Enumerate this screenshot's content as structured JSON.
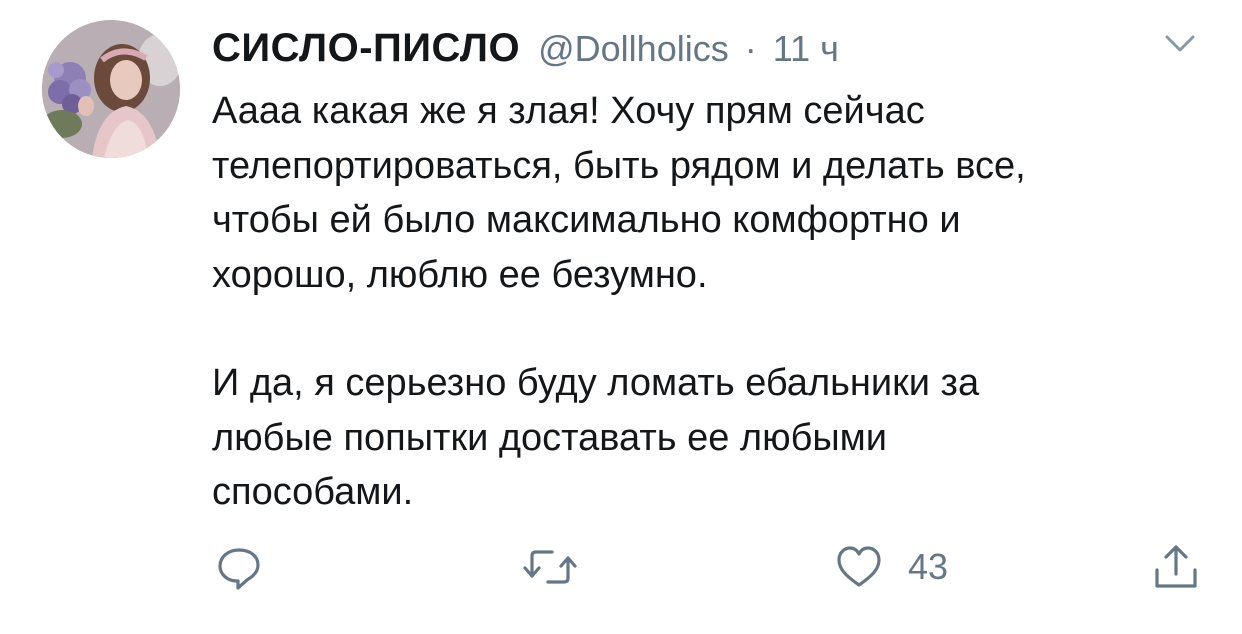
{
  "tweet": {
    "author": {
      "display_name": "СИСЛО-ПИСЛО",
      "handle": "@Dollholics",
      "separator": "·",
      "time": "11 ч"
    },
    "text_paragraph_1": "Аааа какая же я злая! Хочу прям сейчас\nтелепортироваться, быть рядом и делать все,\nчтобы ей было максимально комфортно и\nхорошо,  люблю ее безумно.",
    "text_paragraph_2": "И да, я серьезно буду ломать ебальники за\nлюбые попытки доставать ее любыми\nспособами.",
    "actions": {
      "reply_icon": "reply-icon",
      "retweet_icon": "retweet-icon",
      "like_icon": "heart-icon",
      "like_count": "43",
      "share_icon": "share-icon"
    },
    "menu_icon": "chevron-down-icon"
  },
  "colors": {
    "text_primary": "#14171a",
    "text_secondary": "#657786",
    "icon": "#657786",
    "background": "#ffffff"
  }
}
